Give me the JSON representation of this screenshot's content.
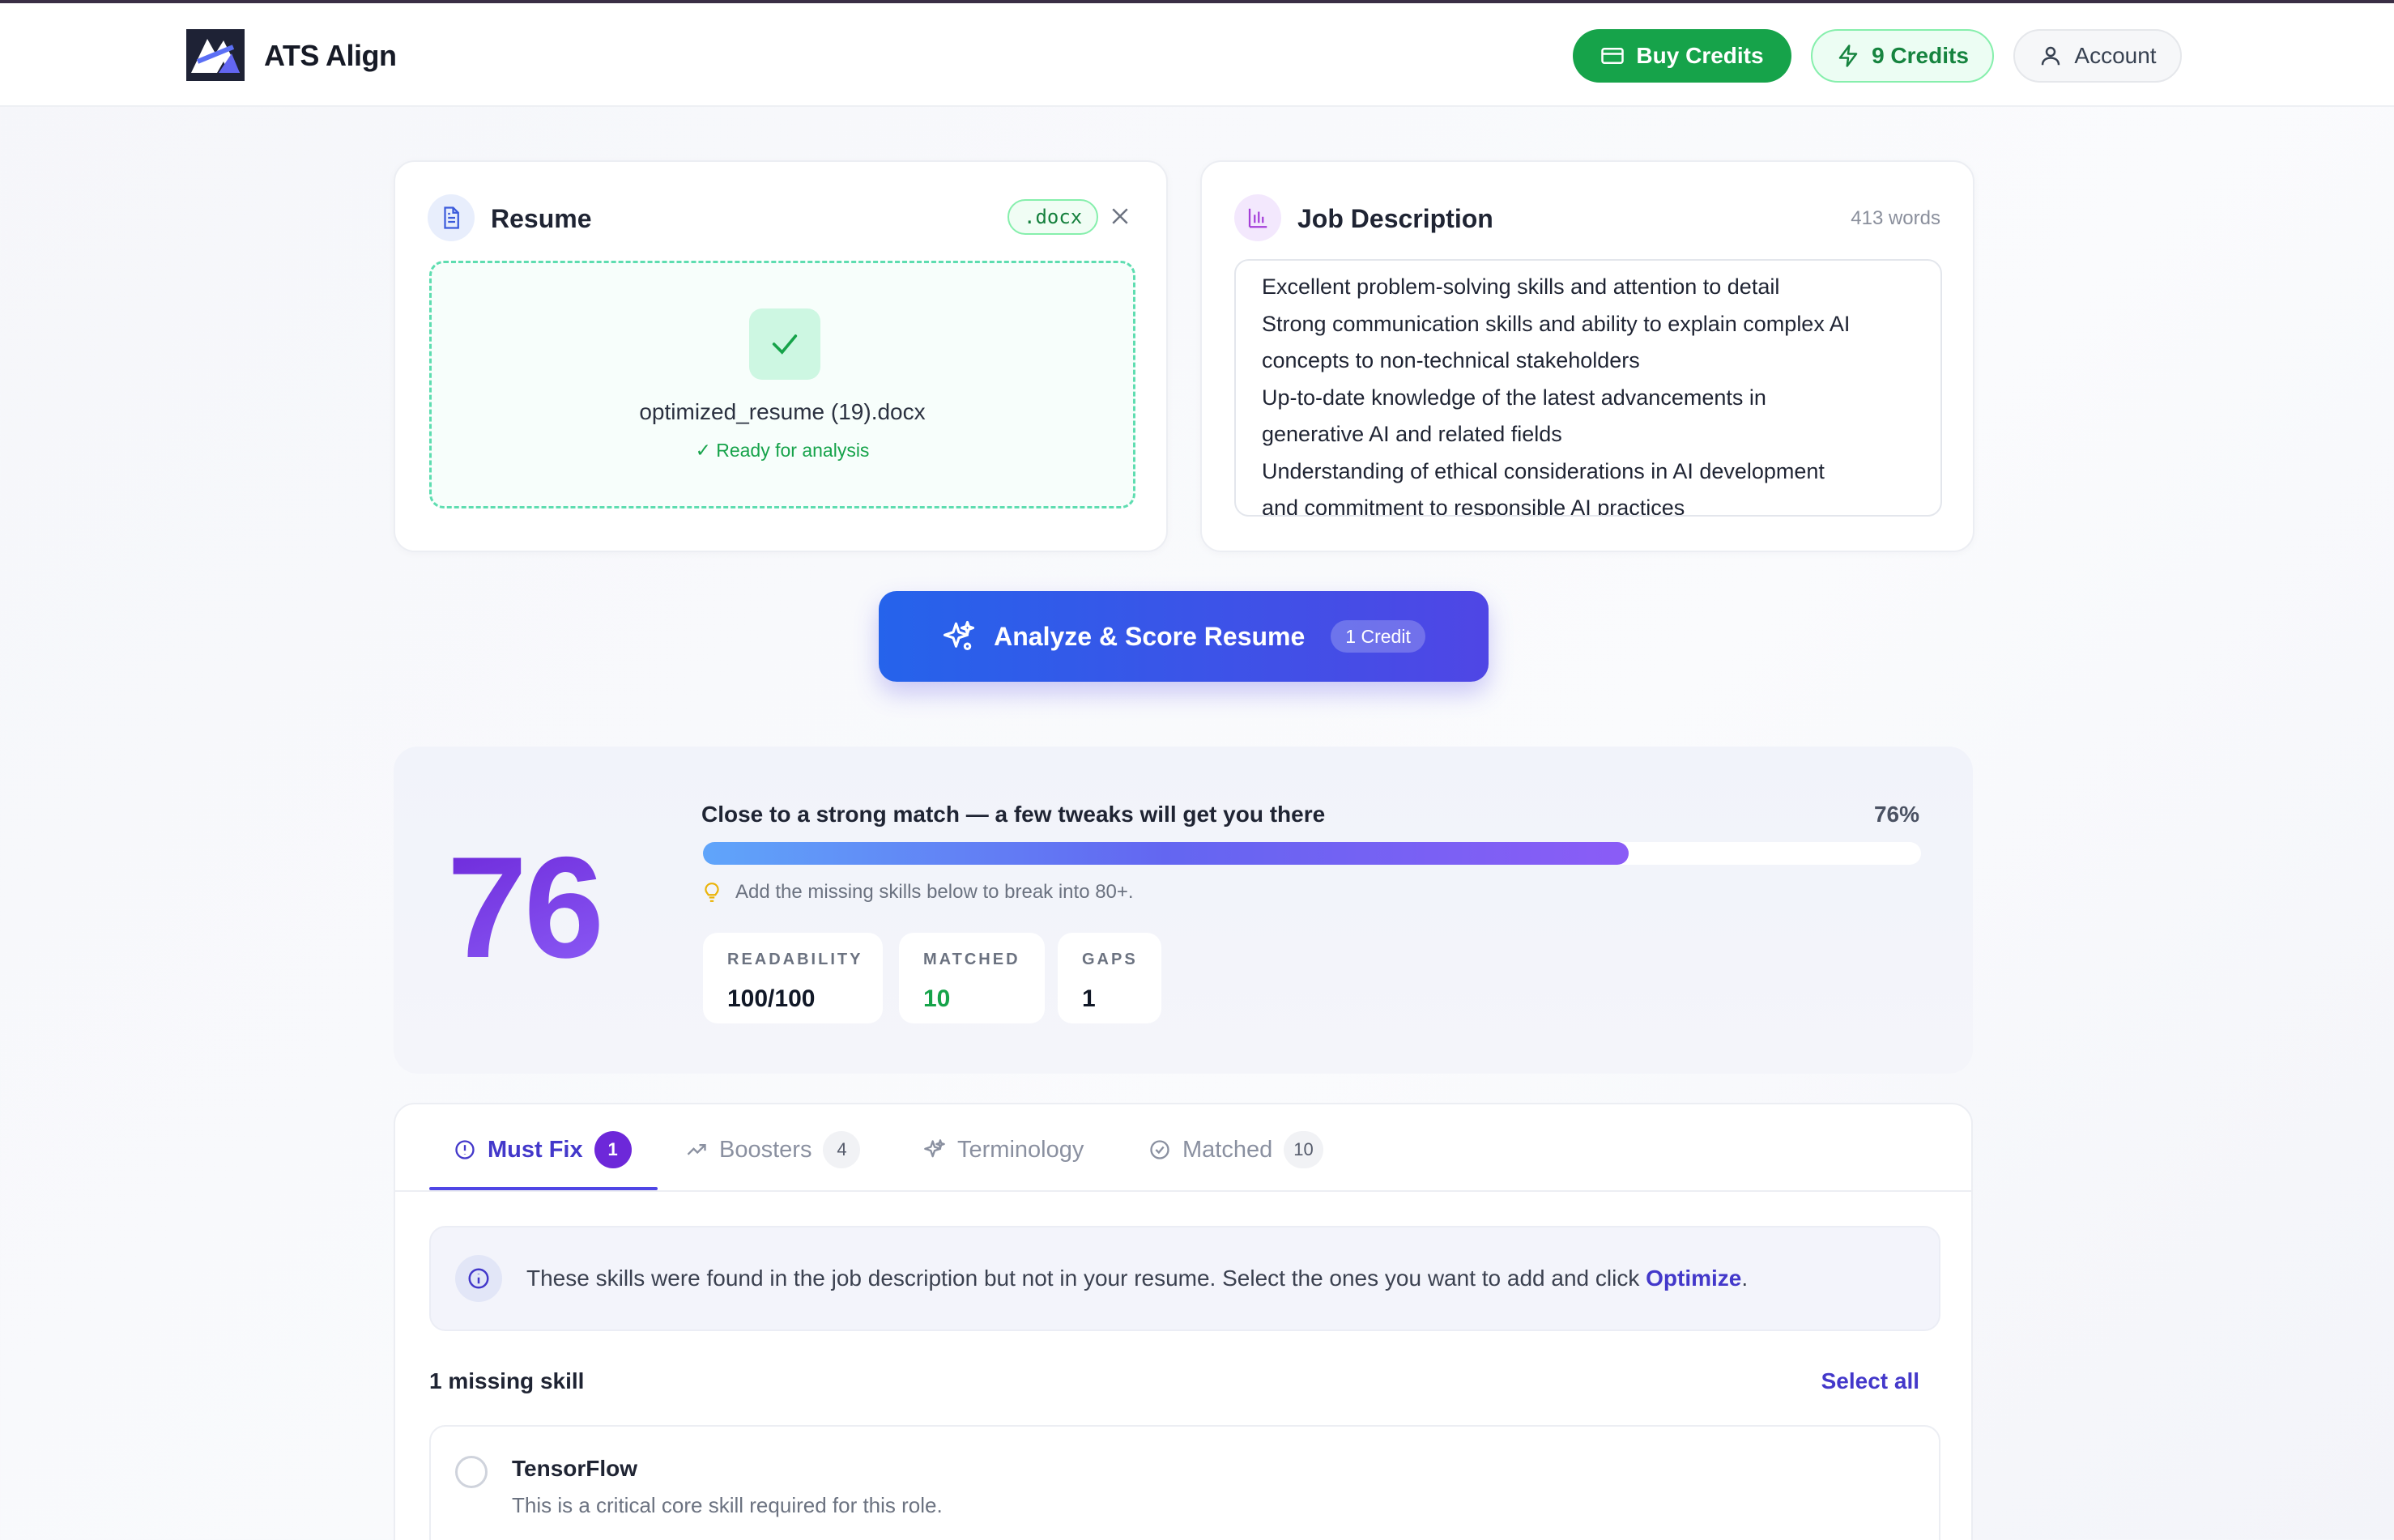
{
  "header": {
    "brand": "ATS Align",
    "buy_credits": "Buy Credits",
    "credits": "9 Credits",
    "account": "Account"
  },
  "resume": {
    "title": "Resume",
    "badge": ".docx",
    "file_name": "optimized_resume (19).docx",
    "status": "✓ Ready for analysis"
  },
  "job_description": {
    "title": "Job Description",
    "word_count": "413 words",
    "lines": [
      "Excellent problem-solving skills and attention to detail",
      "Strong communication skills and ability to explain complex AI",
      "concepts to non-technical stakeholders",
      "Up-to-date knowledge of the latest advancements in",
      "generative AI and related fields",
      "Understanding of ethical considerations in AI development",
      "and commitment to responsible AI practices"
    ]
  },
  "analyze": {
    "label": "Analyze & Score Resume",
    "cost": "1 Credit"
  },
  "score": {
    "value": "76",
    "headline": "Close to a strong match — a few tweaks will get you there",
    "percent_label": "76%",
    "percent": 76,
    "tip": "Add the missing skills below to break into 80+.",
    "stats": {
      "readability_label": "READABILITY",
      "readability_value": "100/100",
      "matched_label": "MATCHED",
      "matched_value": "10",
      "gaps_label": "GAPS",
      "gaps_value": "1"
    }
  },
  "colors": {
    "accent": "#4f46e5",
    "success": "#16a34a",
    "score": "#6d28d9"
  },
  "tabs": [
    {
      "label": "Must Fix",
      "count": "1",
      "icon": "alert-circle-icon",
      "active": true
    },
    {
      "label": "Boosters",
      "count": "4",
      "icon": "trending-up-icon",
      "active": false
    },
    {
      "label": "Terminology",
      "count": "",
      "icon": "sparkles-icon",
      "active": false
    },
    {
      "label": "Matched",
      "count": "10",
      "icon": "check-circle-icon",
      "active": false
    }
  ],
  "info": {
    "text": "These skills were found in the job description but not in your resume. Select the ones you want to add and click ",
    "link": "Optimize",
    "end": "."
  },
  "missing": {
    "title": "1 missing skill",
    "select_all": "Select all",
    "items": [
      {
        "name": "TensorFlow",
        "description": "This is a critical core skill required for this role."
      }
    ]
  }
}
